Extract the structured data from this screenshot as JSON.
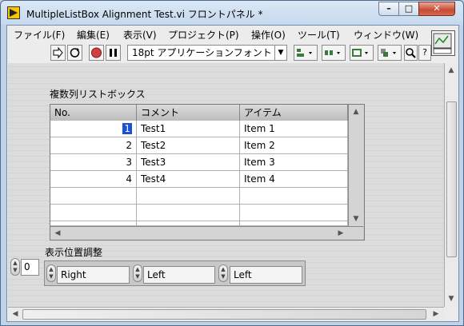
{
  "window": {
    "title": "MultipleListBox Alignment Test.vi フロントパネル *",
    "controls": {
      "minimize": "–",
      "maximize": "□",
      "close": "✕"
    }
  },
  "menubar": [
    "ファイル(F)",
    "編集(E)",
    "表示(V)",
    "プロジェクト(P)",
    "操作(O)",
    "ツール(T)",
    "ウィンドウ(W)"
  ],
  "toolbar": {
    "font": "18pt アプリケーションフォント",
    "run_icon": "run-arrow-icon",
    "run_continuous_icon": "run-continuously-icon",
    "abort_icon": "abort-icon",
    "pause_icon": "pause-icon",
    "align_icon": "align-objects-icon",
    "distribute_icon": "distribute-objects-icon",
    "resize_icon": "resize-objects-icon",
    "reorder_icon": "reorder-icon",
    "search_icon": "search-icon",
    "help_icon": "help-icon",
    "help_label": "?"
  },
  "listbox": {
    "label": "複数列リストボックス",
    "headers": [
      "No.",
      "コメント",
      "アイテム"
    ],
    "rows": [
      [
        "1",
        "Test1",
        "Item 1"
      ],
      [
        "2",
        "Test2",
        "Item 2"
      ],
      [
        "3",
        "Test3",
        "Item 3"
      ],
      [
        "4",
        "Test4",
        "Item 4"
      ],
      [
        "",
        "",
        ""
      ],
      [
        "",
        "",
        ""
      ],
      [
        "",
        "",
        ""
      ]
    ]
  },
  "alignment": {
    "label": "表示位置調整",
    "index_value": "0",
    "rings": [
      "Right",
      "Left",
      "Left"
    ]
  },
  "colors": {
    "selection": "#1a4fd6",
    "panel_bg": "#dcdcdc",
    "close_button": "#c74a34"
  }
}
